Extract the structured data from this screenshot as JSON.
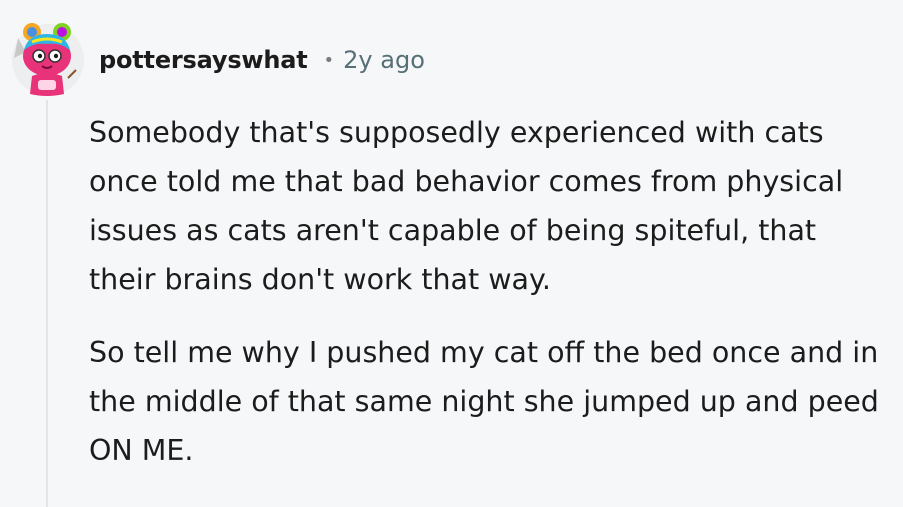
{
  "comment": {
    "author": "pottersayswhat",
    "separator": "•",
    "timestamp": "2y ago",
    "avatar_icon": "snoo-avatar-icon",
    "paragraphs": [
      "Somebody that's supposedly experienced with cats once told me that bad behavior comes from physical issues as cats aren't capable of being spiteful, that their brains don't work that way.",
      "So tell me why I pushed my cat off the bed once and in the middle of that same night she jumped up and peed ON ME."
    ]
  },
  "colors": {
    "background": "#f6f7f8",
    "text": "#1c1c1c",
    "meta": "#576f76",
    "thread_line": "#e3e5e8",
    "avatar_body": "#e8327a"
  }
}
